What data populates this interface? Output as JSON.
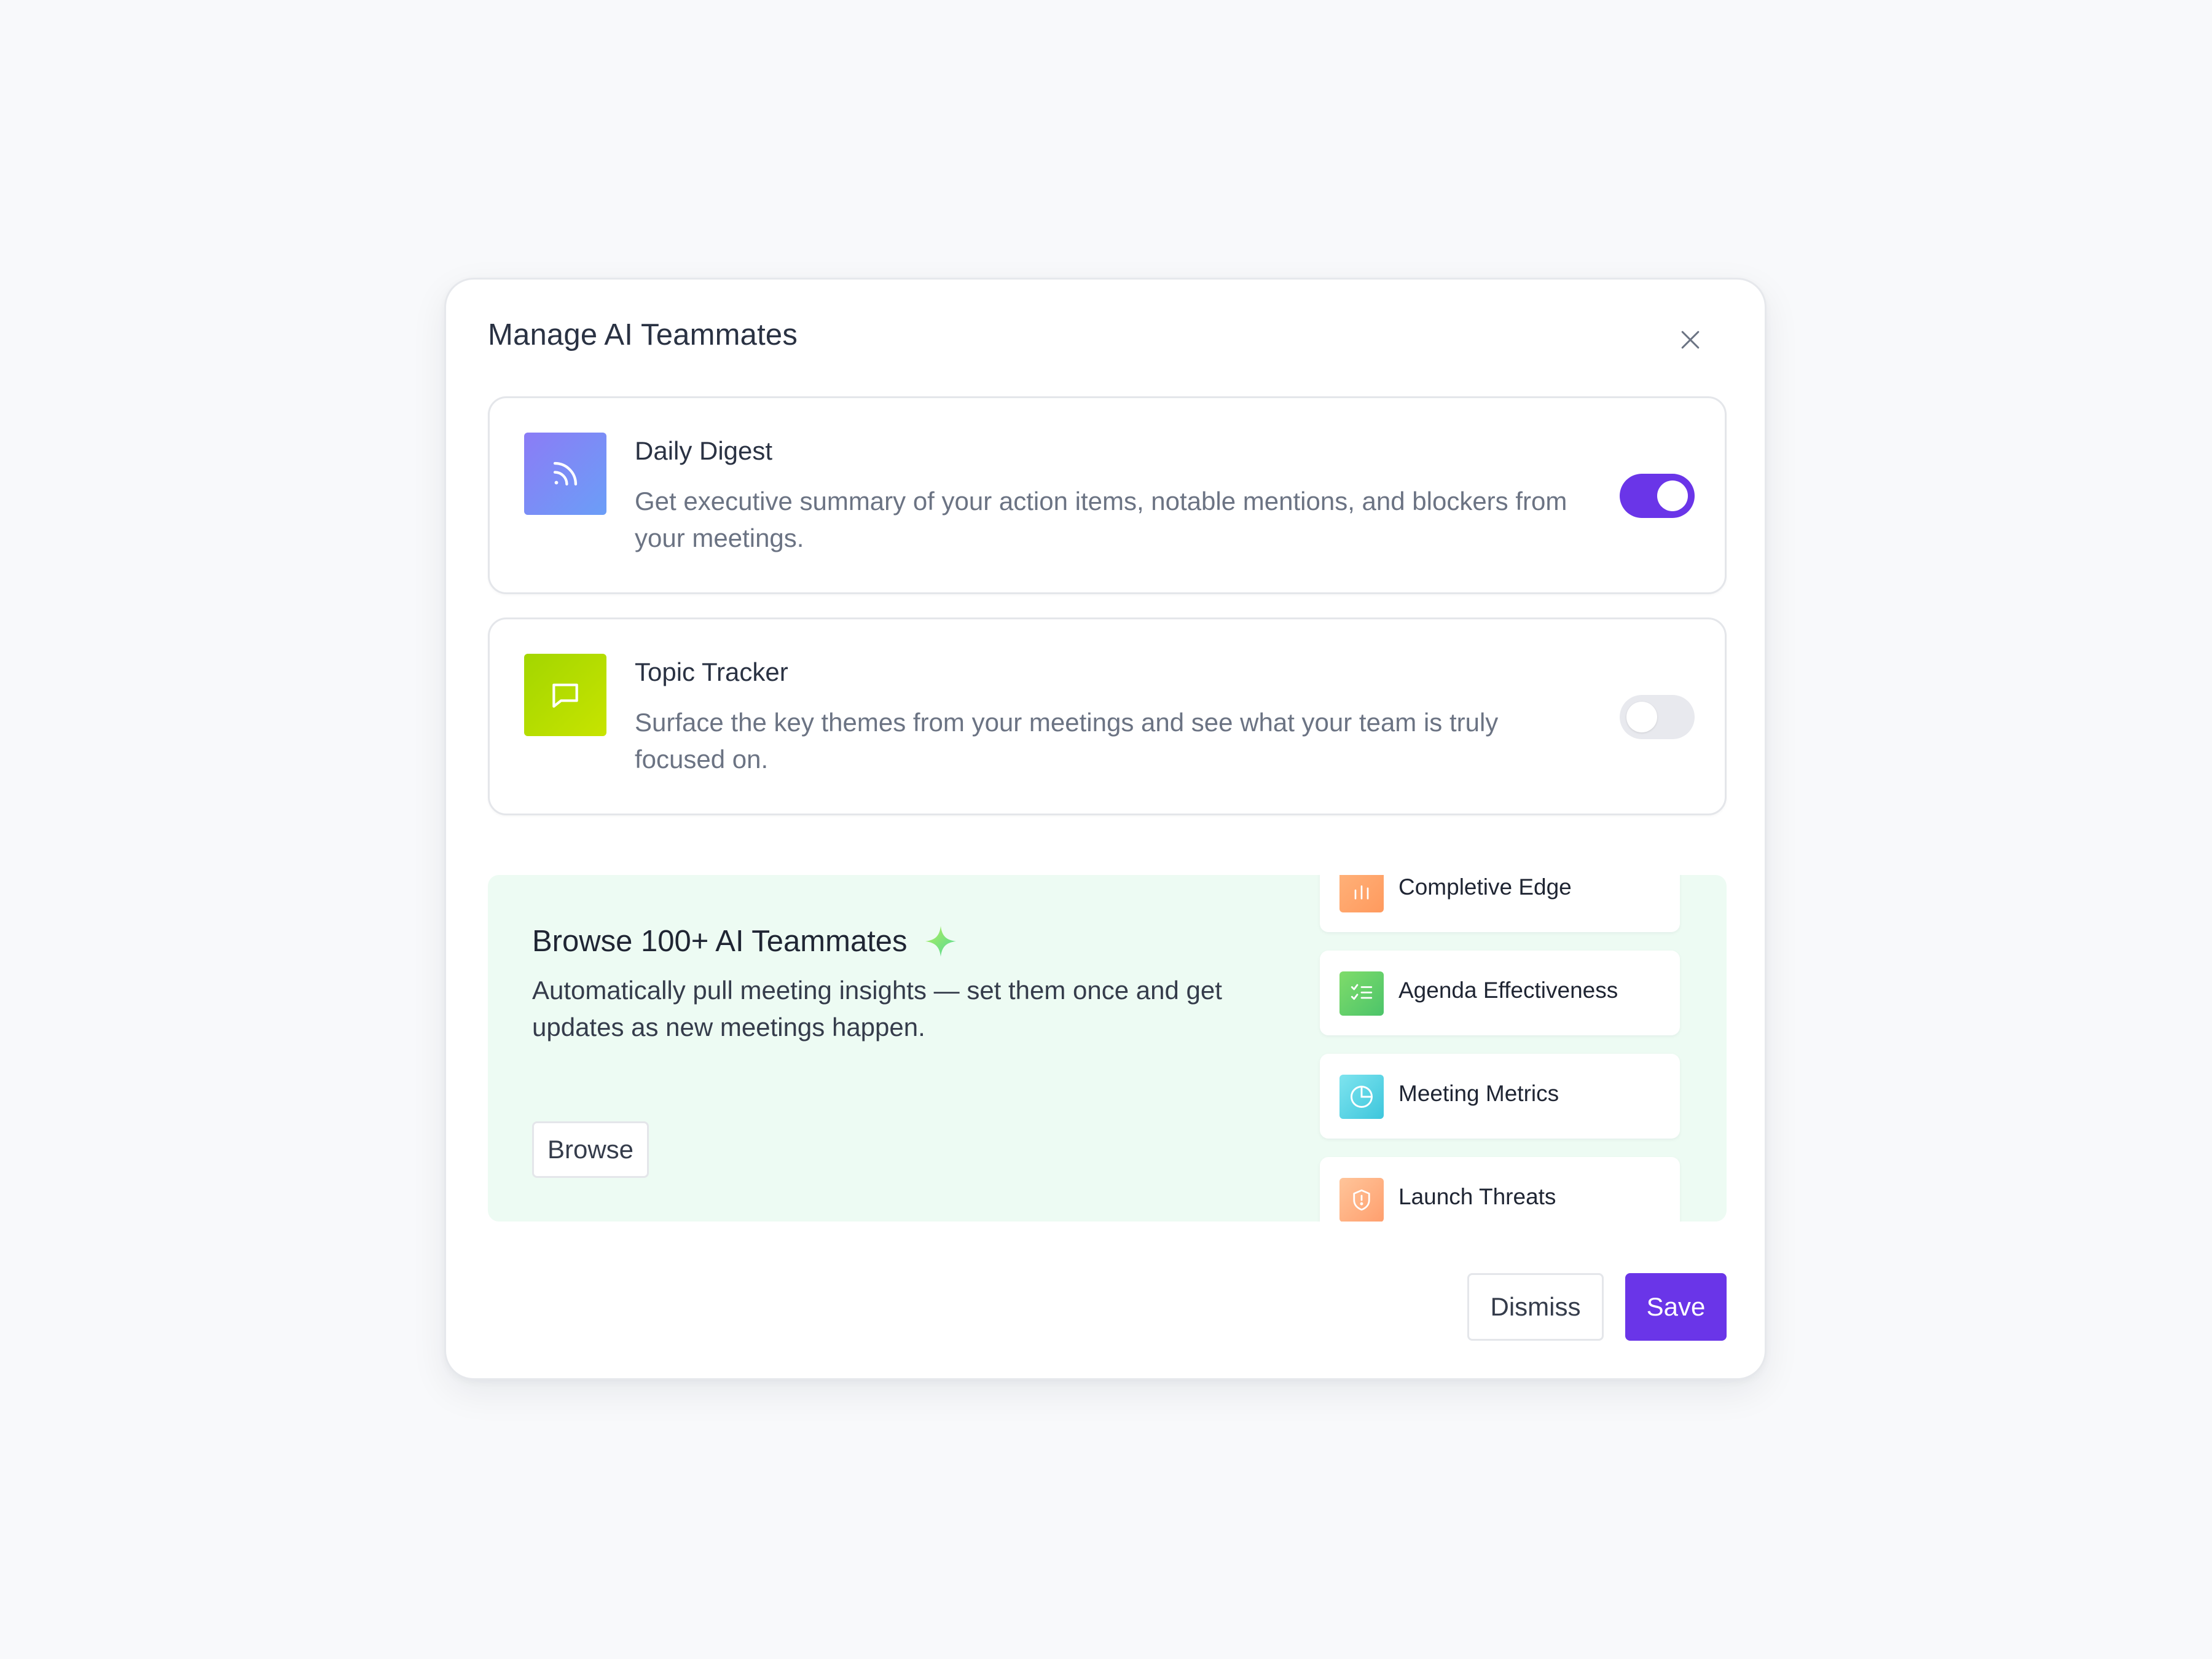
{
  "modal": {
    "title": "Manage AI Teammates",
    "close_icon": "close-icon"
  },
  "teammates": [
    {
      "title": "Daily Digest",
      "description": "Get executive summary of your action items, notable mentions, and blockers from your meetings.",
      "icon": "rss-icon",
      "enabled": true
    },
    {
      "title": "Topic Tracker",
      "description": "Surface the key themes from your meetings and see what your team is truly focused on.",
      "icon": "message-square-icon",
      "enabled": false
    }
  ],
  "browse": {
    "title": "Browse 100+ AI Teammates",
    "description": "Automatically pull meeting insights — set them once and get updates as new meetings happen.",
    "button_label": "Browse",
    "items": [
      {
        "label": "Completive Edge",
        "icon": "bar-chart-icon"
      },
      {
        "label": "Agenda Effectiveness",
        "icon": "checklist-icon"
      },
      {
        "label": "Meeting Metrics",
        "icon": "pie-chart-icon"
      },
      {
        "label": "Launch Threats",
        "icon": "shield-alert-icon"
      }
    ]
  },
  "footer": {
    "dismiss_label": "Dismiss",
    "save_label": "Save"
  },
  "colors": {
    "accent": "#6a35e8",
    "browse_panel_bg": "#edfbf3",
    "page_bg": "#f8f9fb"
  }
}
